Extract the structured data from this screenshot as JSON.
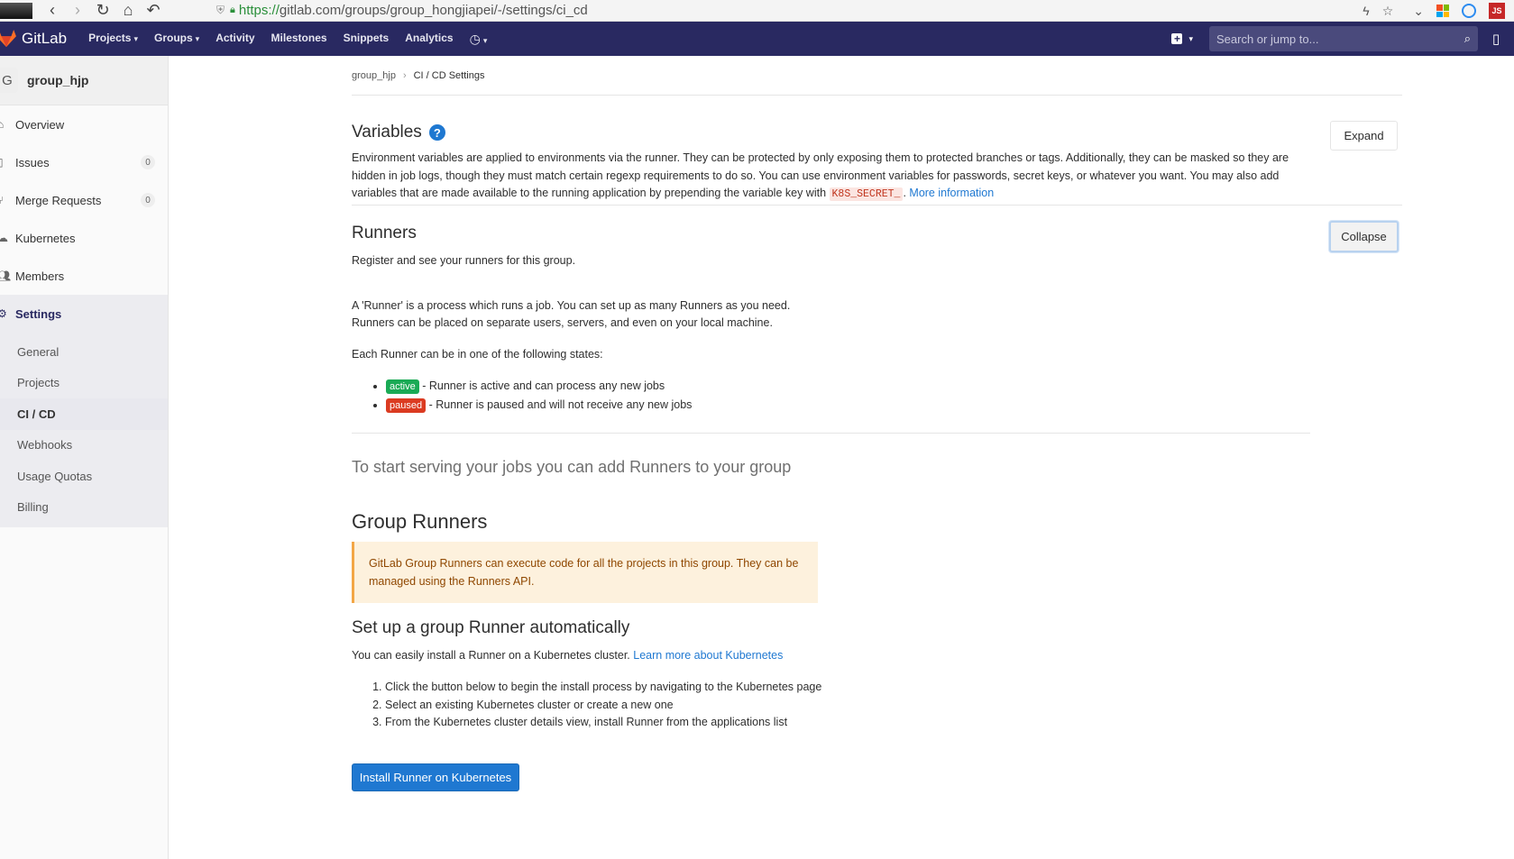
{
  "browser": {
    "url_proto": "https://",
    "url_rest": "gitlab.com/groups/group_hongjiapei/-/settings/ci_cd",
    "ext_js": "JS"
  },
  "navbar": {
    "brand": "GitLab",
    "links": [
      "Projects",
      "Groups",
      "Activity",
      "Milestones",
      "Snippets",
      "Analytics"
    ],
    "search_placeholder": "Search or jump to..."
  },
  "sidebar": {
    "group_avatar": "G",
    "group_name": "group_hjp",
    "items": [
      {
        "label": "Overview"
      },
      {
        "label": "Issues",
        "badge": "0"
      },
      {
        "label": "Merge Requests",
        "badge": "0"
      },
      {
        "label": "Kubernetes"
      },
      {
        "label": "Members"
      },
      {
        "label": "Settings"
      }
    ],
    "settings_sub": [
      "General",
      "Projects",
      "CI / CD",
      "Webhooks",
      "Usage Quotas",
      "Billing"
    ]
  },
  "breadcrumb": {
    "group": "group_hjp",
    "current": "CI / CD Settings"
  },
  "variables": {
    "title": "Variables",
    "desc_1": "Environment variables are applied to environments via the runner. They can be protected by only exposing them to protected branches or tags. Additionally, they can be masked so they are hidden in job logs, though they must match certain regexp requirements to do so. You can use environment variables for passwords, secret keys, or whatever you want. You may also add variables that are made available to the running application by prepending the variable key with",
    "code": "K8S_SECRET_",
    "desc_2": ".",
    "more_info": "More information",
    "expand_label": "Expand"
  },
  "runners": {
    "title": "Runners",
    "subtitle": "Register and see your runners for this group.",
    "collapse_label": "Collapse",
    "intro_1": "A 'Runner' is a process which runs a job. You can set up as many Runners as you need.",
    "intro_2": "Runners can be placed on separate users, servers, and even on your local machine.",
    "states_intro": "Each Runner can be in one of the following states:",
    "active_badge": "active",
    "active_desc": "- Runner is active and can process any new jobs",
    "paused_badge": "paused",
    "paused_desc": "- Runner is paused and will not receive any new jobs",
    "start_serving": "To start serving your jobs you can add Runners to your group"
  },
  "group_runners": {
    "title": "Group Runners",
    "warning": "GitLab Group Runners can execute code for all the projects in this group. They can be managed using the Runners API.",
    "setup_title": "Set up a group Runner automatically",
    "setup_desc": "You can easily install a Runner on a Kubernetes cluster.",
    "learn_more": "Learn more about Kubernetes",
    "steps": [
      "Click the button below to begin the install process by navigating to the Kubernetes page",
      "Select an existing Kubernetes cluster or create a new one",
      "From the Kubernetes cluster details view, install Runner from the applications list"
    ],
    "install_button": "Install Runner on Kubernetes"
  },
  "colors": {
    "navbar": "#292961",
    "primary": "#1f78d1",
    "active_badge": "#1aaa55",
    "paused_badge": "#db3b21",
    "warning_bg": "#fdf1dd"
  }
}
